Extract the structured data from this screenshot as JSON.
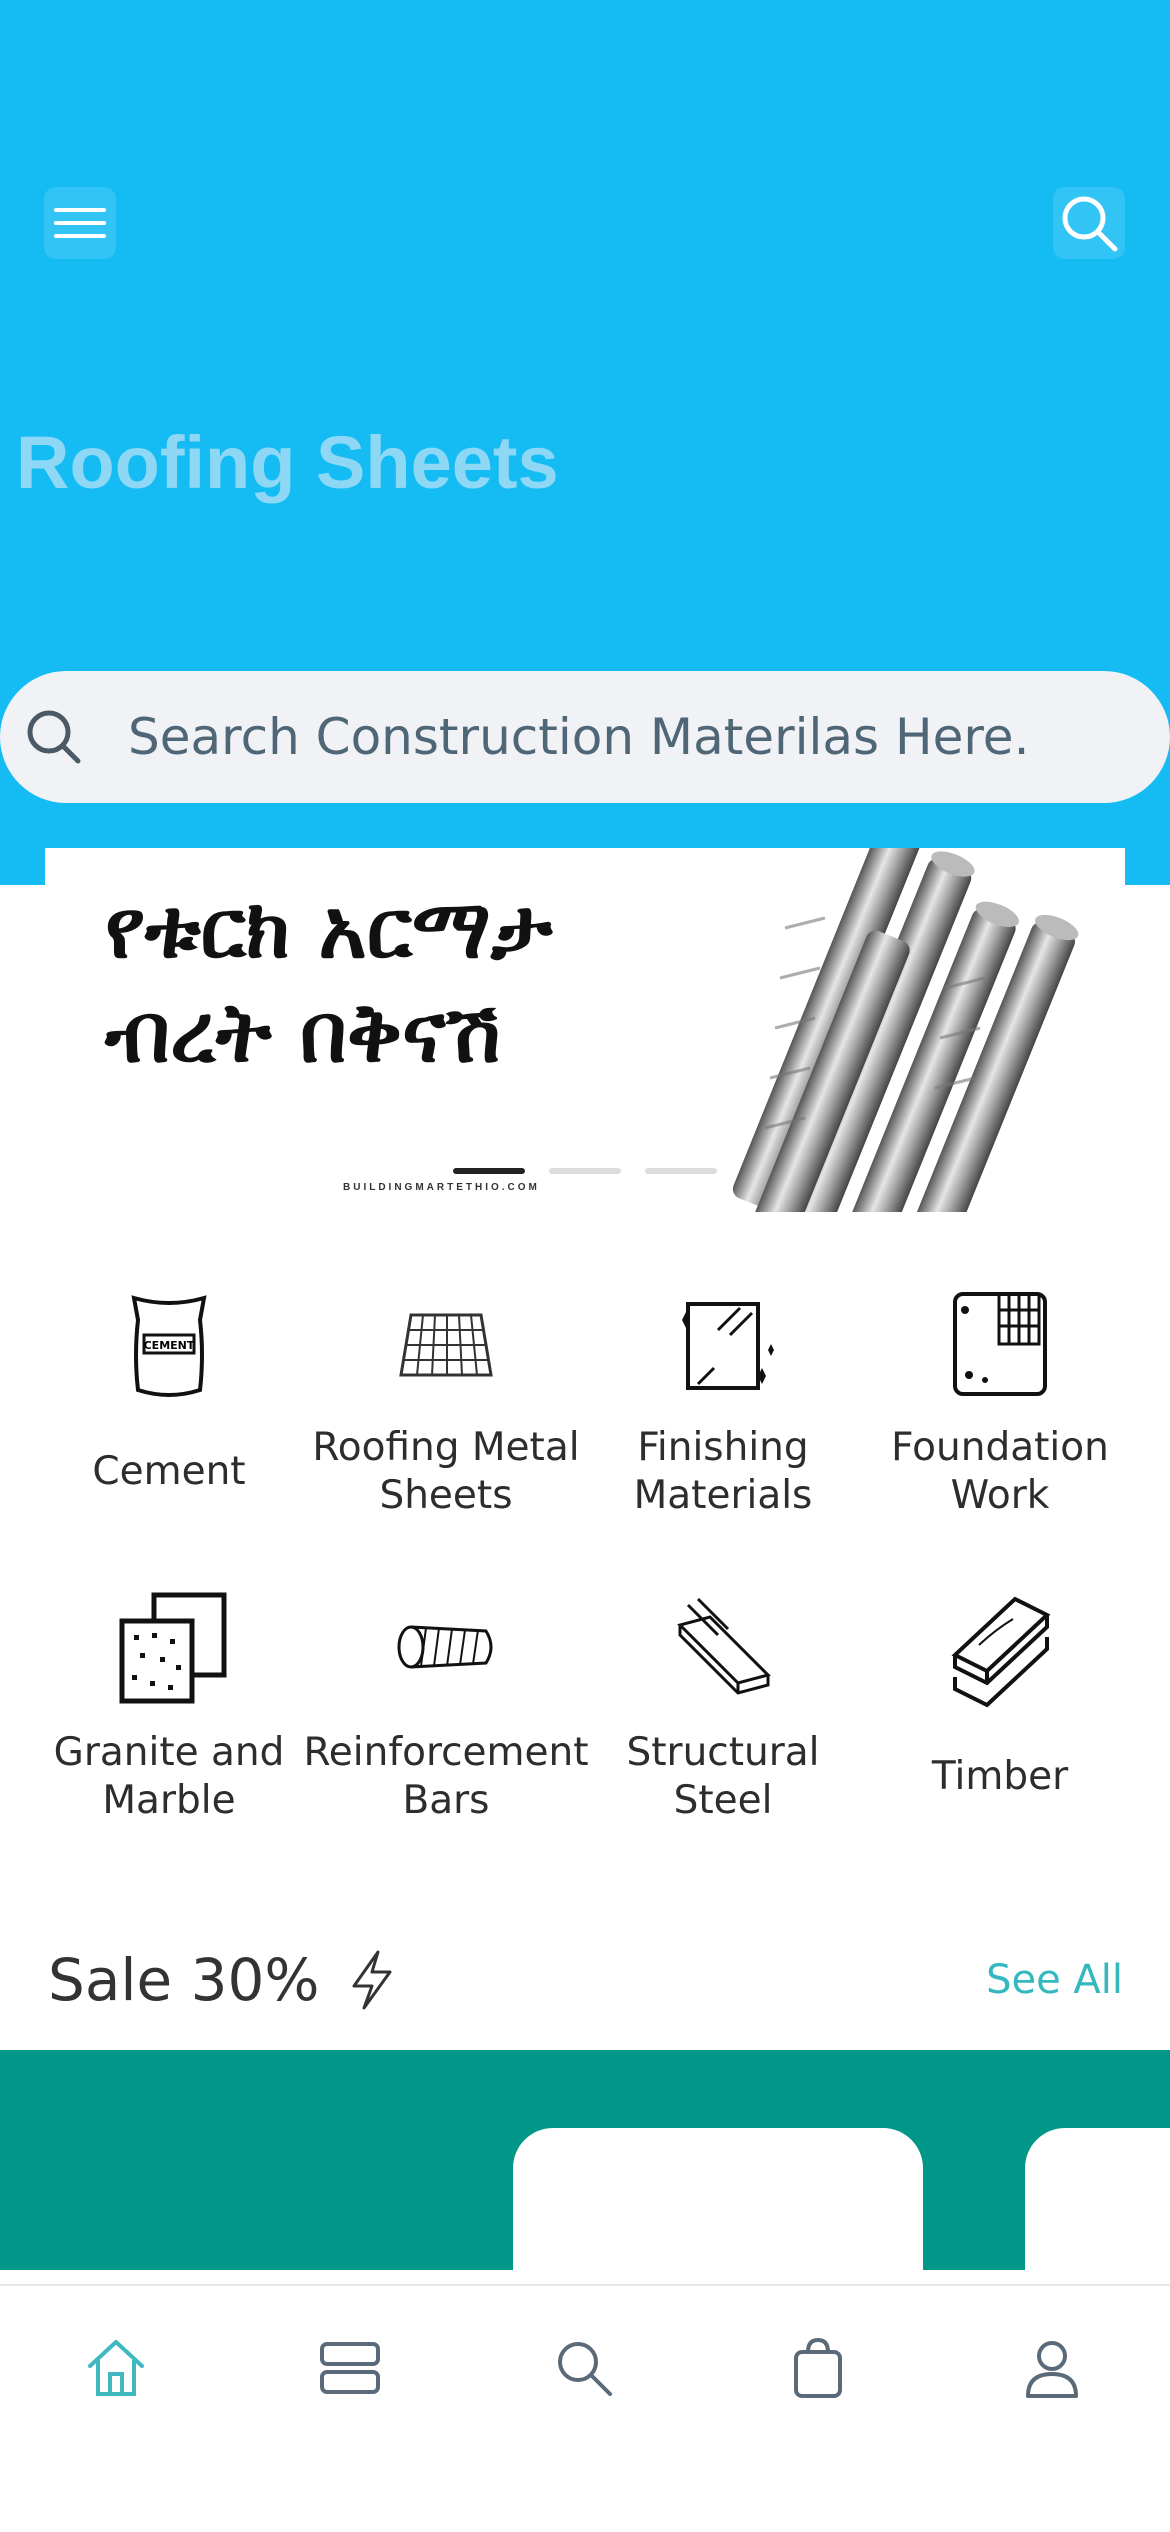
{
  "header": {
    "title": "Roofing Sheets",
    "background_color": "#15bcf3"
  },
  "search": {
    "placeholder": "Search Construction Materilas Here."
  },
  "banner": {
    "headline": "የቱርክ አርማታ\nብረት በቅናሽ",
    "footer": "BUILDINGMARTETHIO.COM",
    "active_slide": 1,
    "slide_count": 3
  },
  "categories": [
    {
      "label": "Cement",
      "icon": "cement-bag-icon"
    },
    {
      "label": "Roofing Metal Sheets",
      "icon": "roofing-sheet-icon"
    },
    {
      "label": "Finishing Materials",
      "icon": "glass-panel-icon"
    },
    {
      "label": "Foundation Work",
      "icon": "foundation-icon"
    },
    {
      "label": "Granite and Marble",
      "icon": "tiles-icon"
    },
    {
      "label": "Reinforcement Bars",
      "icon": "rebar-icon"
    },
    {
      "label": "Structural Steel",
      "icon": "steel-beam-icon"
    },
    {
      "label": "Timber",
      "icon": "timber-planks-icon"
    }
  ],
  "sale": {
    "title": "Sale 30%",
    "see_all": "See All",
    "accent_color": "#34b8c0",
    "band_color": "#009688"
  },
  "bottom_nav": [
    {
      "name": "home",
      "icon": "home-icon",
      "active": true
    },
    {
      "name": "categories",
      "icon": "layers-icon",
      "active": false
    },
    {
      "name": "search",
      "icon": "search-icon",
      "active": false
    },
    {
      "name": "cart",
      "icon": "shopping-bag-icon",
      "active": false
    },
    {
      "name": "profile",
      "icon": "user-icon",
      "active": false
    }
  ]
}
